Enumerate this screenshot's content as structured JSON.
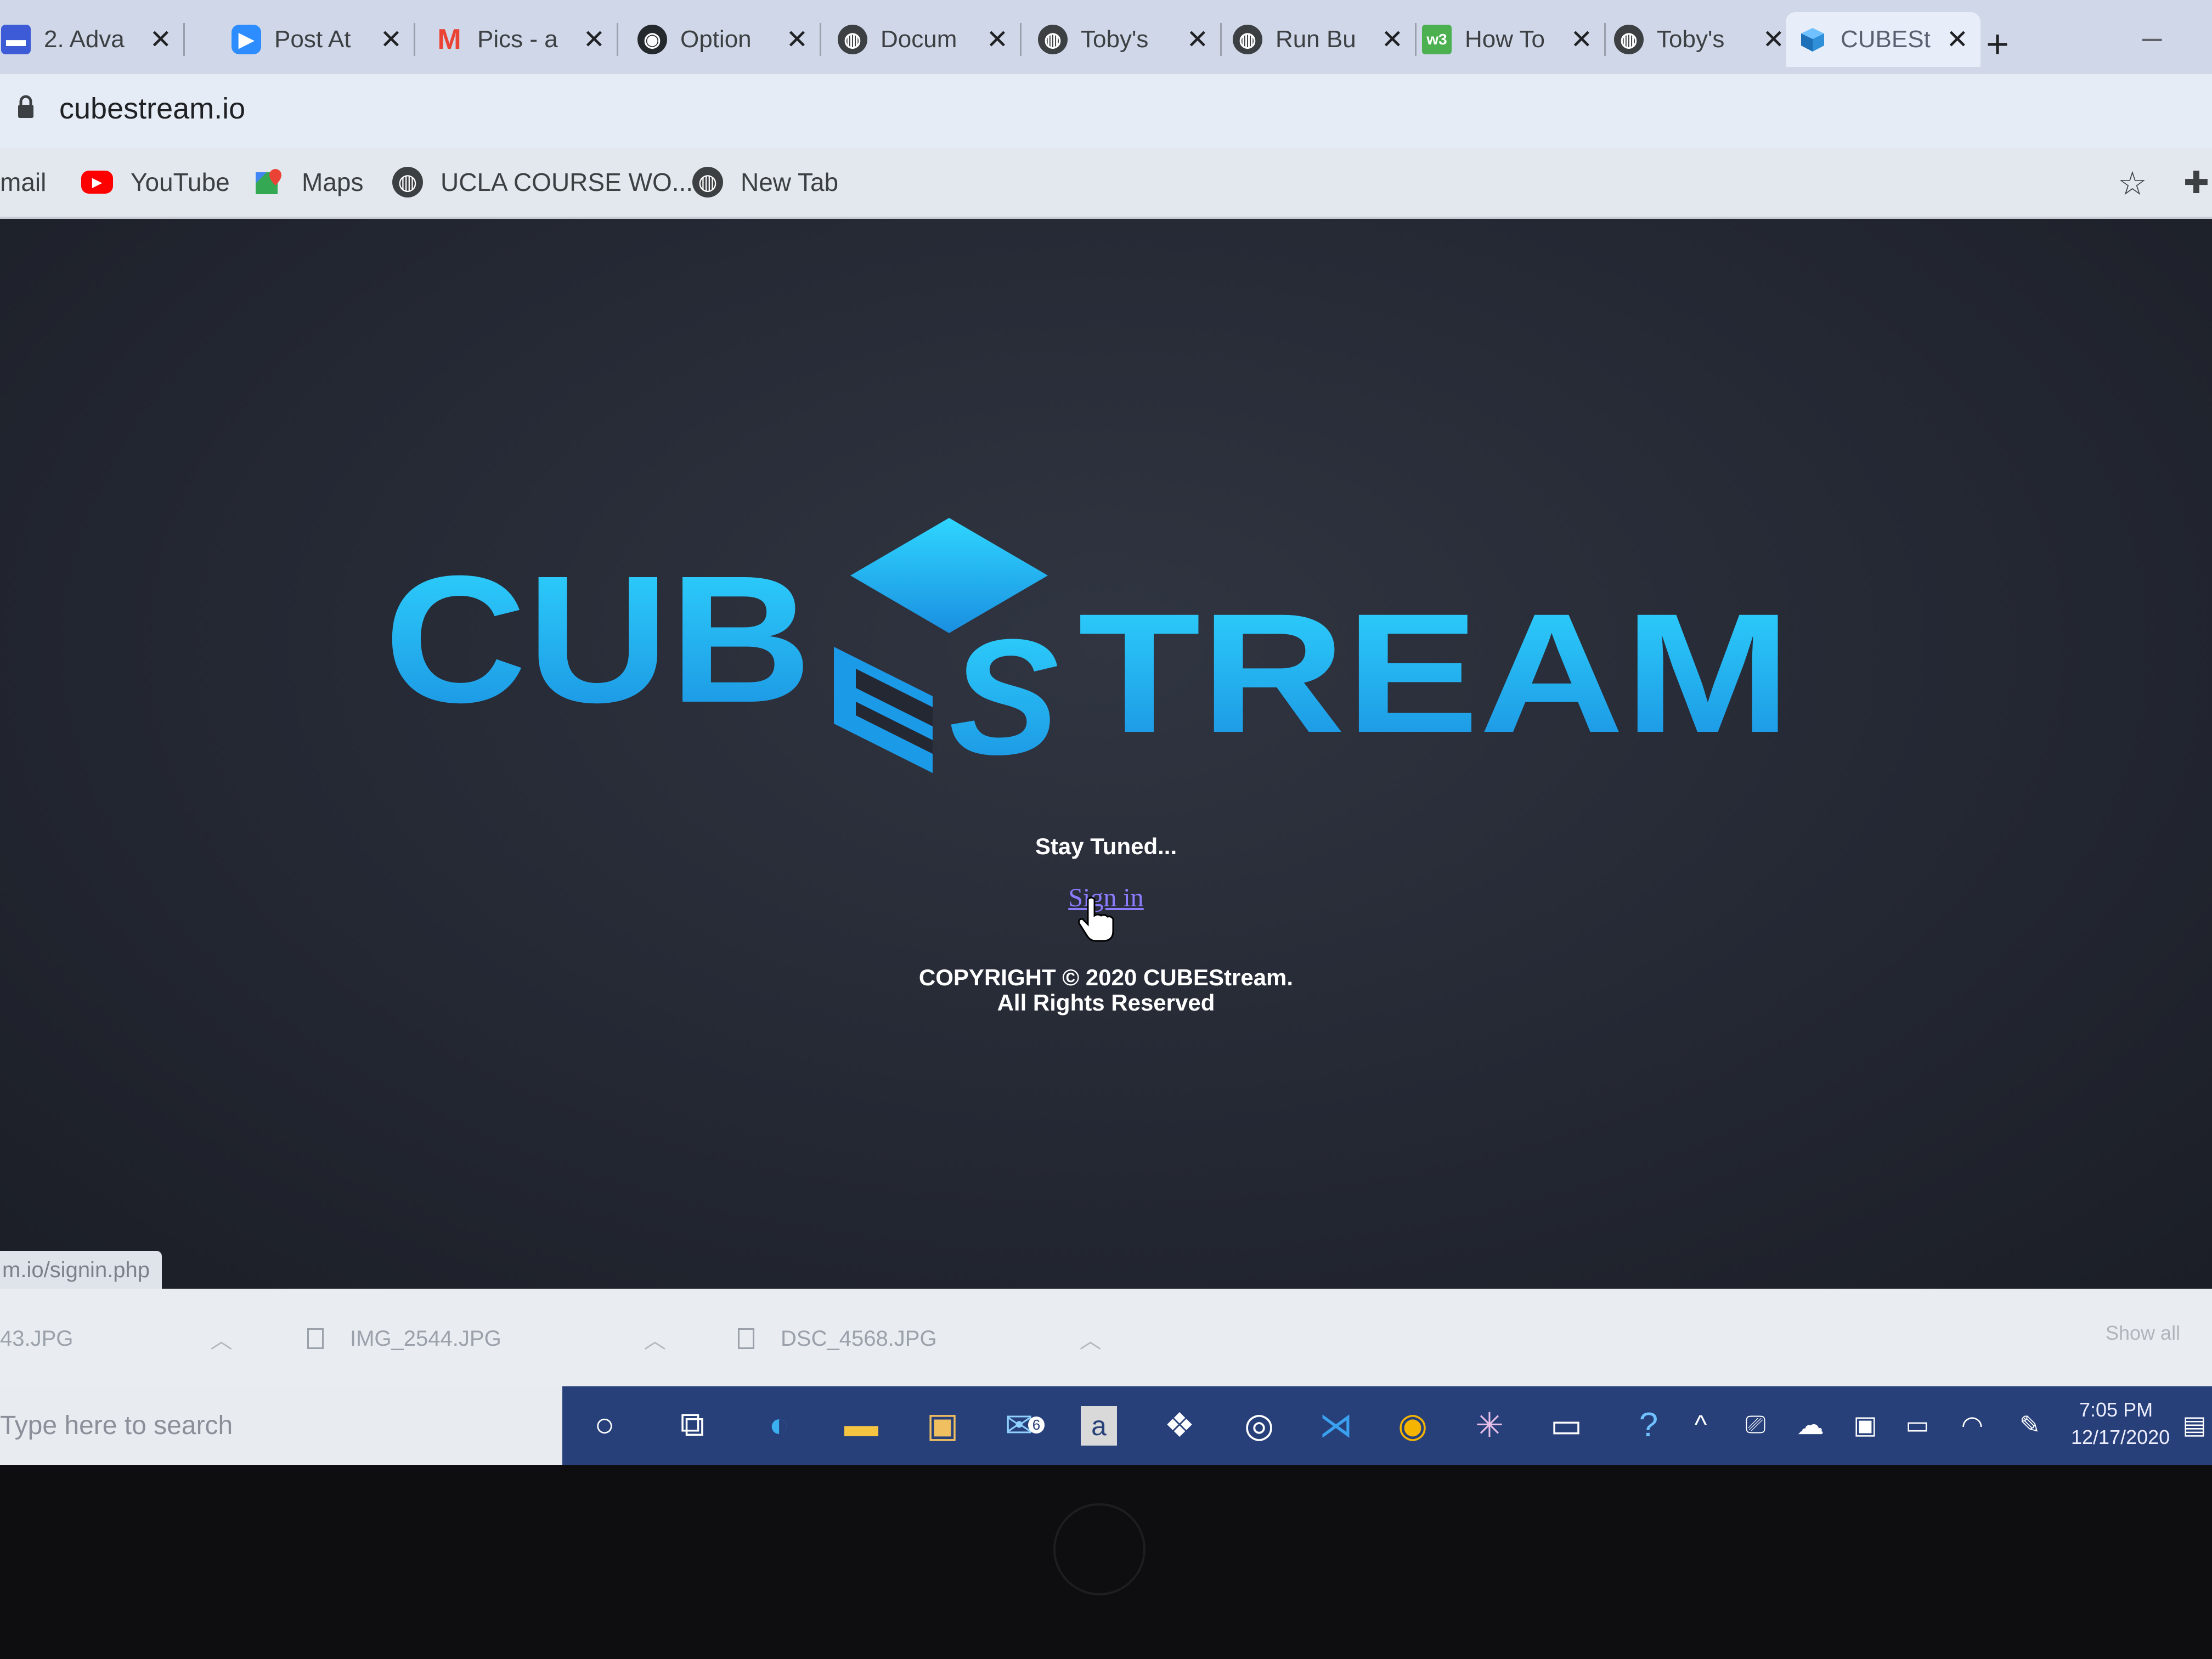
{
  "tabs": [
    {
      "title": "2. Adva",
      "icon": "course-icon",
      "color": "#3d5bd6"
    },
    {
      "title": "Post At",
      "icon": "zoom-icon",
      "color": "#2d8cff"
    },
    {
      "title": "Pics - a",
      "icon": "gmail-icon",
      "color": "#ea4335"
    },
    {
      "title": "Option",
      "icon": "github-icon",
      "color": "#24292e"
    },
    {
      "title": "Docum",
      "icon": "globe-icon",
      "color": "#3c4043"
    },
    {
      "title": "Toby's",
      "icon": "globe-icon",
      "color": "#3c4043"
    },
    {
      "title": "Run Bu",
      "icon": "globe-icon",
      "color": "#3c4043"
    },
    {
      "title": "How To",
      "icon": "w3schools-icon",
      "color": "#4caf50"
    },
    {
      "title": "Toby's",
      "icon": "globe-icon",
      "color": "#3c4043"
    },
    {
      "title": "CUBESt",
      "icon": "cube-icon",
      "color": "#2f8fd8"
    }
  ],
  "address": {
    "url": "cubestream.io"
  },
  "bookmarks": [
    {
      "label": "mail"
    },
    {
      "label": "YouTube",
      "icon": "youtube-icon"
    },
    {
      "label": "Maps",
      "icon": "maps-icon"
    },
    {
      "label": "UCLA COURSE WO...",
      "icon": "globe-icon"
    },
    {
      "label": "New Tab",
      "icon": "globe-icon"
    }
  ],
  "page": {
    "logo_text": "CUBESTREAM",
    "logo_color_top": "#2fd6ff",
    "logo_color_bottom": "#1a8fe0",
    "stay_tuned": "Stay Tuned...",
    "signin": "Sign in",
    "copyright_line1": "COPYRIGHT © 2020 CUBEStream.",
    "copyright_line2": "All Rights Reserved"
  },
  "status_url": "m.io/signin.php",
  "downloads": {
    "items": [
      "43.JPG",
      "IMG_2544.JPG",
      "DSC_4568.JPG"
    ],
    "show_all": "Show all"
  },
  "taskbar": {
    "search_placeholder": "Type here to search",
    "mail_badge": "6",
    "time": "7:05 PM",
    "date": "12/17/2020"
  }
}
